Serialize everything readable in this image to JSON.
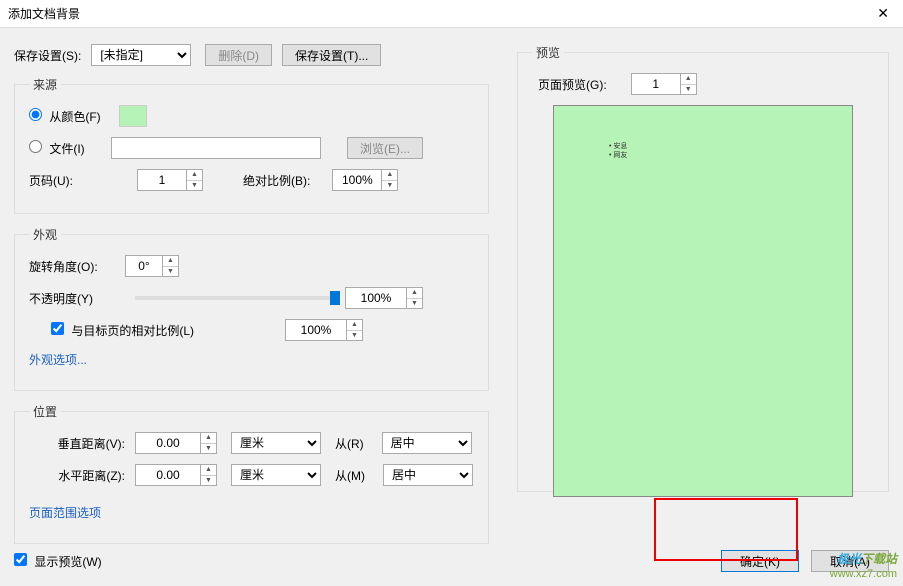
{
  "window": {
    "title": "添加文档背景"
  },
  "save": {
    "label": "保存设置(S):",
    "combo_value": "[未指定]",
    "delete_btn": "删除(D)",
    "save_btn": "保存设置(T)..."
  },
  "source": {
    "legend": "来源",
    "from_color": "从颜色(F)",
    "file": "文件(I)",
    "file_path": "",
    "browse": "浏览(E)...",
    "page_label": "页码(U):",
    "page_value": "1",
    "scale_label": "绝对比例(B):",
    "scale_value": "100%"
  },
  "appearance": {
    "legend": "外观",
    "rotation_label": "旋转角度(O):",
    "rotation_value": "0°",
    "opacity_label": "不透明度(Y)",
    "opacity_value": "100%",
    "relative_scale_chk": "与目标页的相对比例(L)",
    "relative_scale_value": "100%",
    "options_link": "外观选项..."
  },
  "position": {
    "legend": "位置",
    "vdist_label": "垂直距离(V):",
    "vdist_value": "0.00",
    "hdist_label": "水平距离(Z):",
    "hdist_value": "0.00",
    "unit": "厘米",
    "from_label_v": "从(R)",
    "from_label_h": "从(M)",
    "align": "居中",
    "range_link": "页面范围选项"
  },
  "preview": {
    "legend": "预览",
    "page_preview_label": "页面预览(G):",
    "page_value": "1",
    "doc_line1": "安息",
    "doc_line2": "网友"
  },
  "footer": {
    "show_preview": "显示预览(W)",
    "ok": "确定(K)",
    "cancel": "取消(A)"
  },
  "watermark": {
    "brand_a": "极光",
    "brand_b": "下载站",
    "url": "www.xz7.com"
  }
}
